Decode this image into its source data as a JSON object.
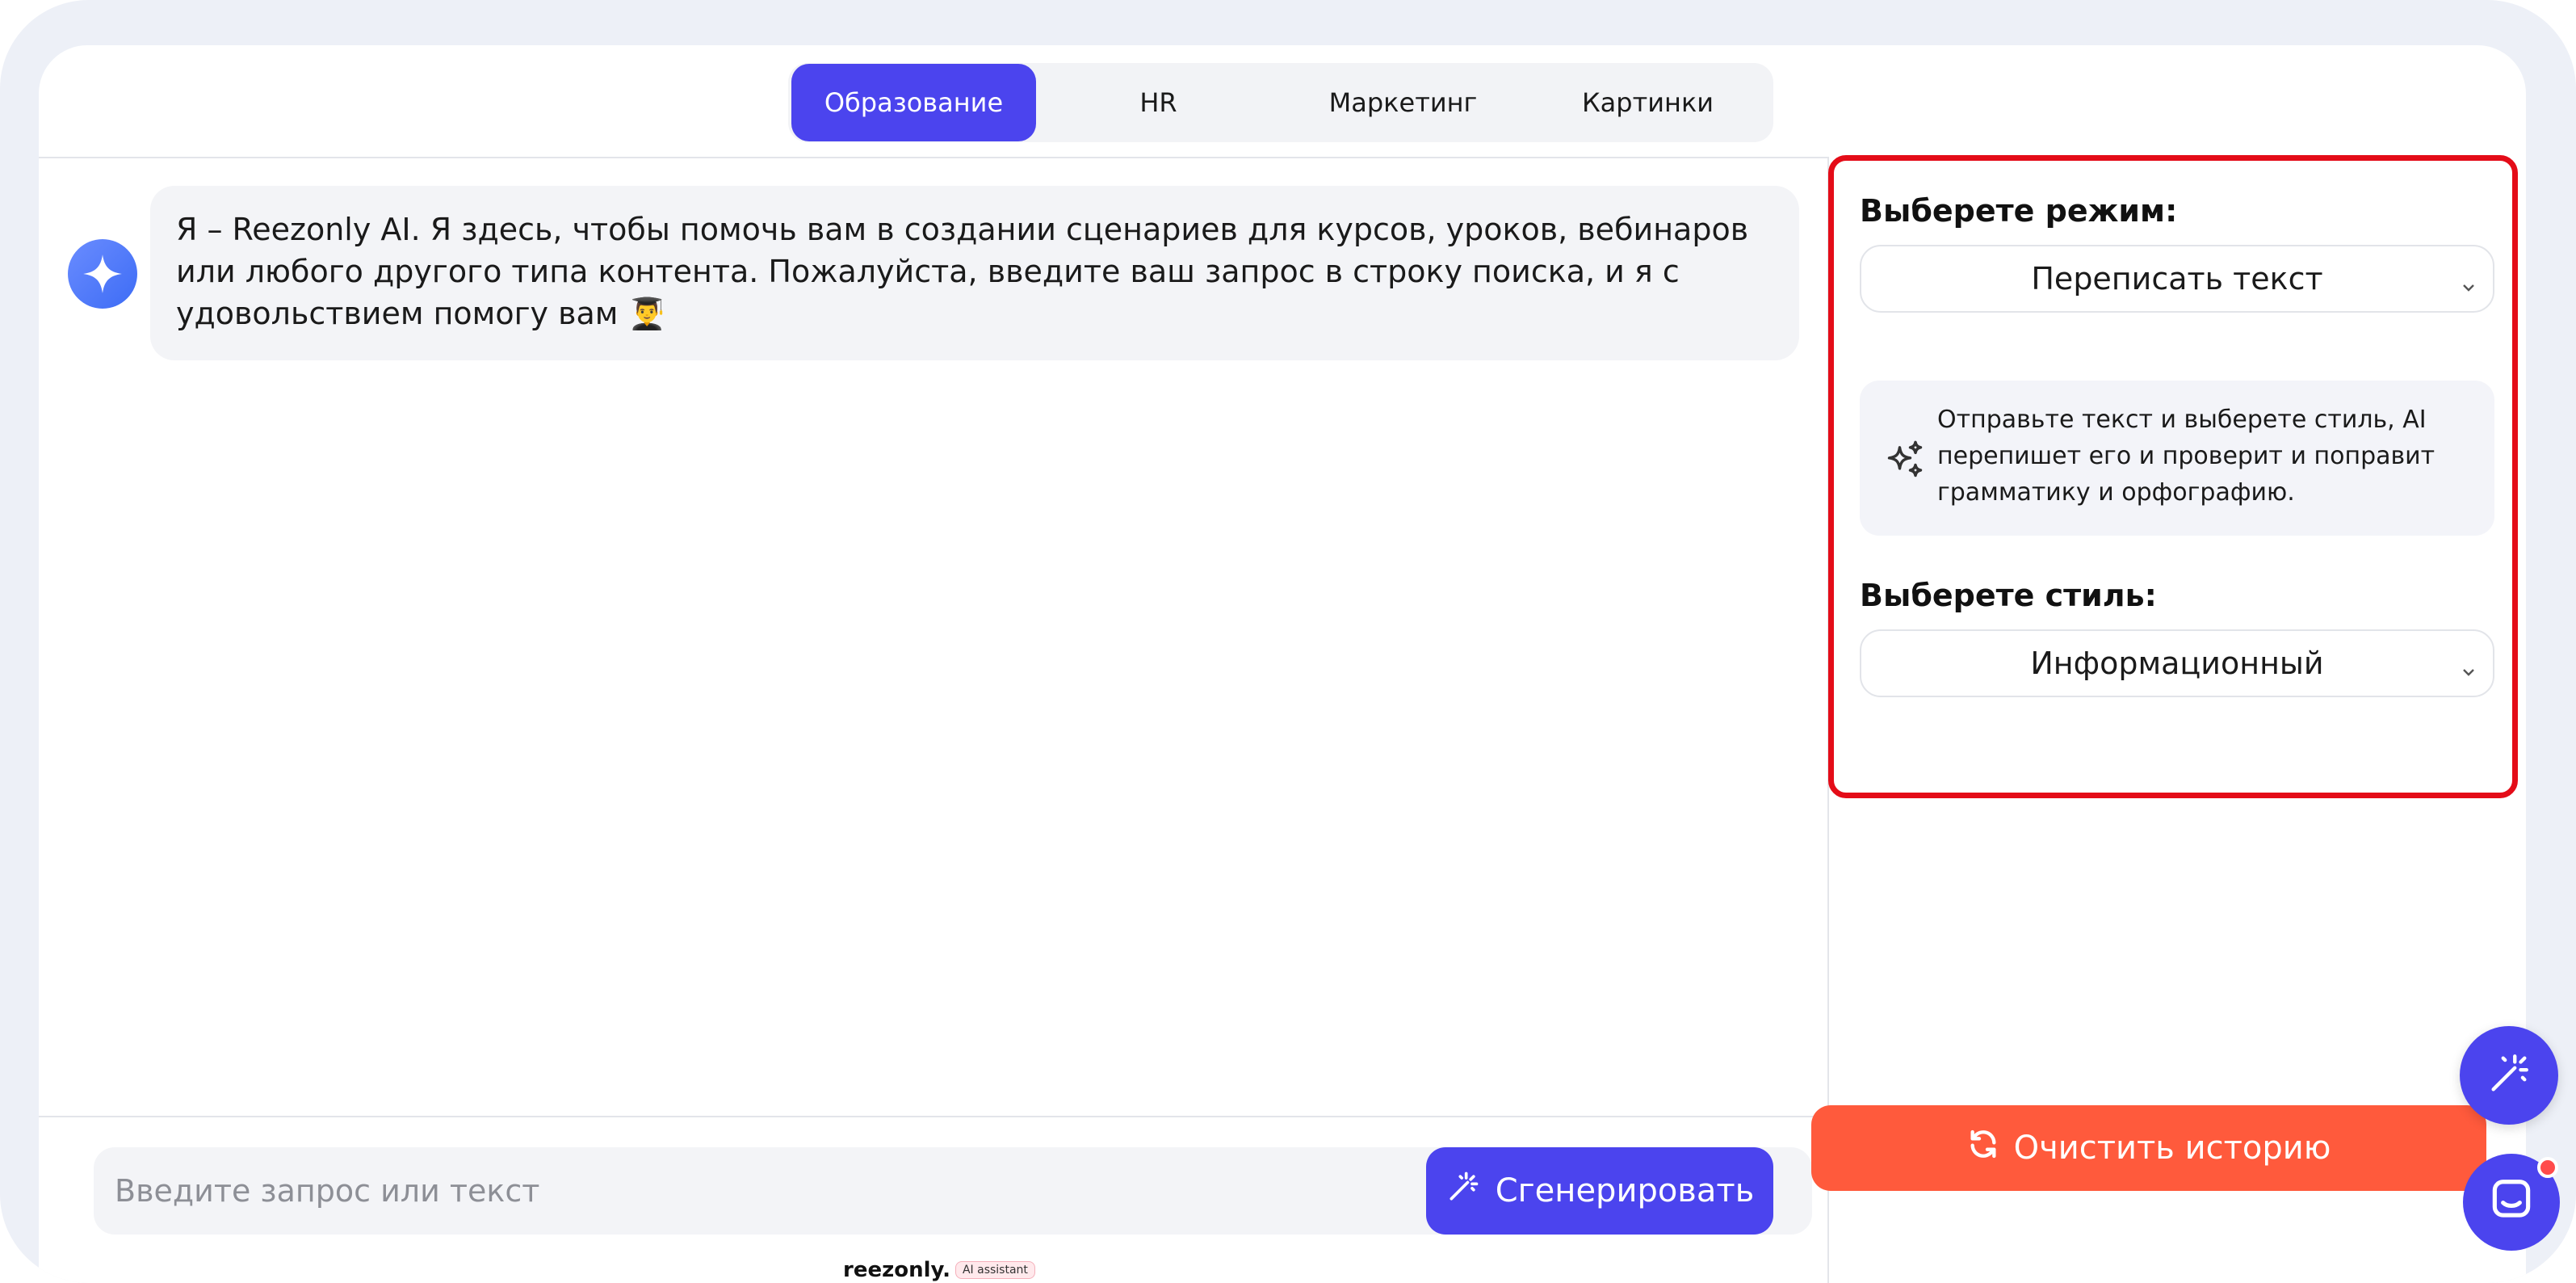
{
  "tabs": [
    {
      "label": "Образование",
      "active": true
    },
    {
      "label": "HR",
      "active": false
    },
    {
      "label": "Маркетинг",
      "active": false
    },
    {
      "label": "Картинки",
      "active": false
    }
  ],
  "chat": {
    "assistant_icon": "sparkle-icon",
    "message": "Я – Reezonly AI.  Я здесь, чтобы помочь вам в создании сценариев для курсов, уроков, вебинаров или любого другого типа контента. Пожалуйста, введите ваш запрос в строку поиска, и я с удовольствием помогу вам 👨‍🎓"
  },
  "composer": {
    "placeholder": "Введите запрос или текст",
    "generate_label": "Сгенерировать",
    "generate_icon": "magic-wand-icon"
  },
  "brand": {
    "name": "reezonly.",
    "tag": "AI assistant"
  },
  "settings": {
    "mode_label": "Выберете режим:",
    "mode_value": "Переписать текст",
    "info_icon": "sparkles-icon",
    "info_text": "Отправьте текст и выберете стиль, AI перепишет его и проверит и поправит грамматику и орфографию.",
    "style_label": "Выберете стиль:",
    "style_value": "Информационный"
  },
  "clear_label": "Очистить историю",
  "clear_icon": "refresh-icon",
  "colors": {
    "accent": "#4b44ee",
    "clear": "#ff5a3c",
    "highlight_border": "#e40c18"
  }
}
